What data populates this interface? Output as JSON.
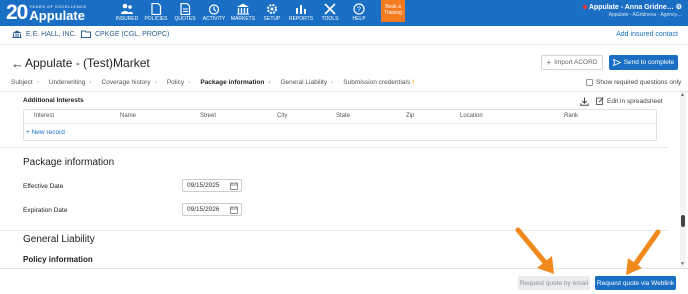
{
  "header": {
    "logo_number": "20",
    "logo_tagline": "YEARS OF EXCELLENCE",
    "logo_brand": "Appulate",
    "nav": [
      {
        "label": "INSURED",
        "icon": "users-icon"
      },
      {
        "label": "POLICIES",
        "icon": "document-icon"
      },
      {
        "label": "QUOTES",
        "icon": "quote-document-icon"
      },
      {
        "label": "ACTIVITY",
        "icon": "activity-icon"
      },
      {
        "label": "MARKETS",
        "icon": "bank-icon"
      },
      {
        "label": "SETUP",
        "icon": "gear-icon"
      },
      {
        "label": "REPORTS",
        "icon": "bar-chart-icon"
      },
      {
        "label": "TOOLS",
        "icon": "tools-icon"
      },
      {
        "label": "HELP",
        "icon": "help-icon"
      }
    ],
    "training_label_line1": "Book a",
    "training_label_line2": "Training",
    "user_name": "Appulate - Anna Gridne…",
    "user_org": "Appulate - AGridneva - Agency…"
  },
  "subbar": {
    "insured": "E.E. HALL, INC.",
    "policy": "CPKGE (CGL, PROPC)",
    "add_contact": "Add insured contact"
  },
  "page": {
    "back": "←",
    "title": "Appulate - (Test)Market",
    "import_label": "Import ACORD",
    "send_label": "Send to complete"
  },
  "tabs": [
    {
      "label": "Subject",
      "active": false
    },
    {
      "label": "Underwriting",
      "active": false
    },
    {
      "label": "Coverage history",
      "active": false
    },
    {
      "label": "Policy",
      "active": false
    },
    {
      "label": "Package information",
      "active": true
    },
    {
      "label": "General Liability",
      "active": false
    },
    {
      "label": "Submission credentials",
      "active": false,
      "badge": "!"
    }
  ],
  "required_only_label": "Show required questions only",
  "additional_interests": {
    "title": "Additional Interests",
    "edit_label": "Edit in spreadsheet",
    "columns": [
      "Interest",
      "Name",
      "Street",
      "City",
      "State",
      "Zip",
      "Location",
      "Rank"
    ],
    "new_record": "New record"
  },
  "package": {
    "title": "Package information",
    "effective_label": "Effective Date",
    "effective_value": "09/15/2025",
    "expiration_label": "Expiration Date",
    "expiration_value": "09/15/2026"
  },
  "general_liability": {
    "title": "General Liability",
    "subtitle": "Policy information"
  },
  "footer": {
    "email_label": "Request quote by email",
    "weblink_label": "Request quote via Weblink"
  },
  "colors": {
    "brand_blue": "#1a6fc4",
    "accent_orange": "#f47b20",
    "arrow_orange": "#f08a1c"
  }
}
